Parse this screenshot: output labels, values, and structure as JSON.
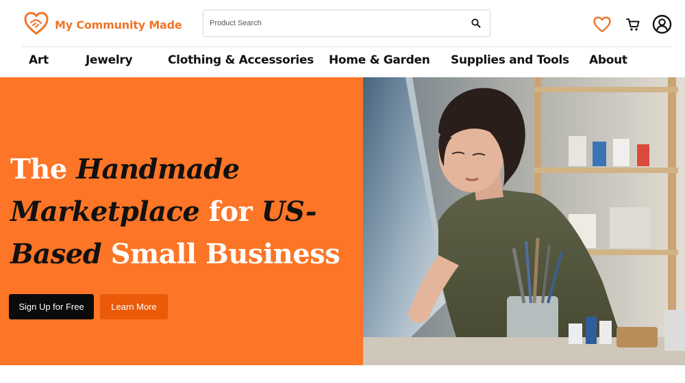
{
  "brand": {
    "name": "My Community Made",
    "color": "#f07426",
    "logo_icon": "heart-hands-icon"
  },
  "search": {
    "placeholder": "Product Search",
    "value": "",
    "icon": "search-icon"
  },
  "header_icons": [
    {
      "name": "favorites",
      "icon": "heart-icon",
      "color": "#f07426"
    },
    {
      "name": "cart",
      "icon": "cart-icon"
    },
    {
      "name": "account",
      "icon": "user-circle-icon"
    }
  ],
  "nav": {
    "items": [
      "Art",
      "Jewelry",
      "Clothing & Accessories",
      "Home & Garden",
      "Supplies and Tools",
      "About"
    ]
  },
  "hero": {
    "background": "#fd7526",
    "headline": {
      "p1": "The ",
      "p2": "Handmade",
      "p3": "Marketplace",
      "p4": " for ",
      "p5": "US-Based",
      "p6": " Small Business"
    },
    "primary_button": "Sign Up for Free",
    "secondary_button": "Learn More",
    "image": "artist-painting-photo"
  }
}
